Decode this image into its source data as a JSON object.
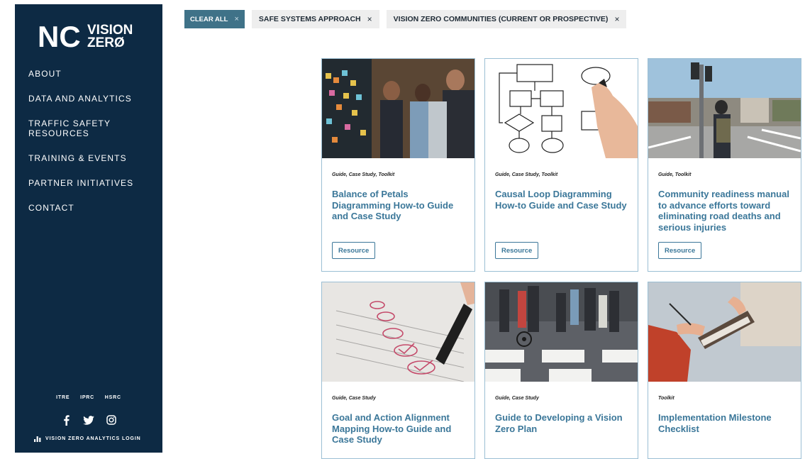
{
  "sidebar": {
    "logo": {
      "nc": "NC",
      "vision": "VISION",
      "zero": "ZERØ"
    },
    "nav": [
      "ABOUT",
      "DATA AND ANALYTICS",
      "TRAFFIC SAFETY RESOURCES",
      "TRAINING & EVENTS",
      "PARTNER INITIATIVES",
      "CONTACT"
    ],
    "orgs": [
      "ITRE",
      "IPRC",
      "HSRC"
    ],
    "social_icons": [
      "facebook-icon",
      "twitter-icon",
      "instagram-icon"
    ],
    "login_label": "VISION ZERO ANALYTICS LOGIN"
  },
  "filters": {
    "clear_all": "CLEAR ALL",
    "remove_symbol": "×",
    "chips": [
      "SAFE SYSTEMS APPROACH",
      "VISION ZERO COMMUNITIES (CURRENT OR PROSPECTIVE)"
    ]
  },
  "cards": [
    {
      "tags": "Guide, Case Study, Toolkit",
      "title": "Balance of Petals Diagramming How-to Guide and Case Study",
      "button": "Resource"
    },
    {
      "tags": "Guide, Case Study, Toolkit",
      "title": "Causal Loop Diagramming How-to Guide and Case Study",
      "button": "Resource"
    },
    {
      "tags": "Guide, Toolkit",
      "title": "Community readiness manual to advance efforts toward eliminating road deaths and serious injuries",
      "button": "Resource"
    },
    {
      "tags": "Guide, Case Study",
      "title": "Goal and Action Alignment Mapping How-to Guide and Case Study"
    },
    {
      "tags": "Guide, Case Study",
      "title": "Guide to Developing a Vision Zero Plan"
    },
    {
      "tags": "Toolkit",
      "title": "Implementation Milestone Checklist"
    }
  ],
  "colors": {
    "sidebar_bg": "#0d2a44",
    "accent": "#3b7799",
    "clear_chip": "#3f7288",
    "card_border": "#9bbfd4"
  }
}
